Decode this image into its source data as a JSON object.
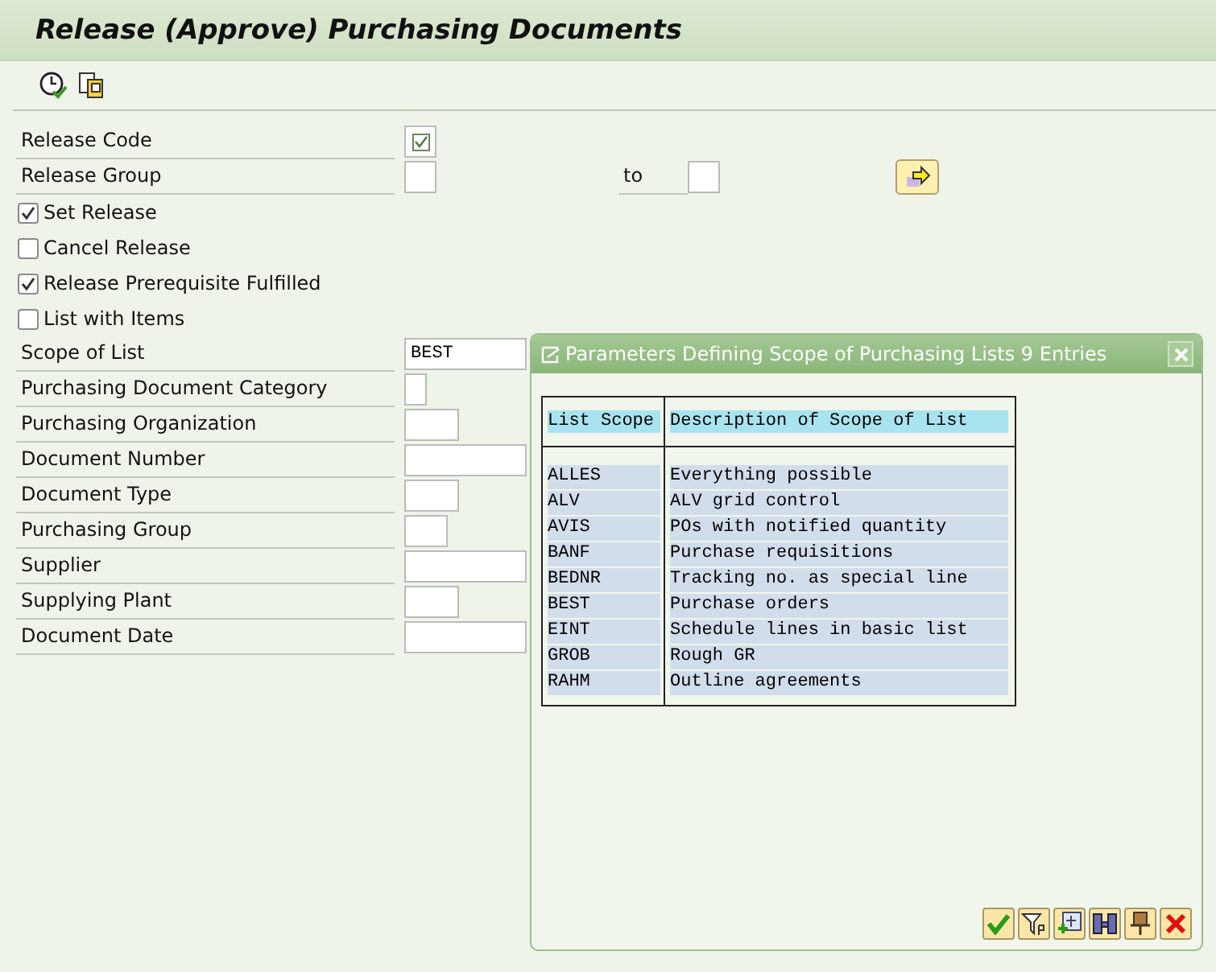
{
  "window": {
    "title": "Release (Approve) Purchasing Documents"
  },
  "form": [
    {
      "kind": "checkfield",
      "label": "Release Code",
      "checked": true
    },
    {
      "kind": "range",
      "label": "Release Group",
      "to_label": "to"
    },
    {
      "kind": "checkbox",
      "label": "Set Release",
      "checked": true
    },
    {
      "kind": "checkbox",
      "label": "Cancel Release",
      "checked": false
    },
    {
      "kind": "checkbox",
      "label": "Release Prerequisite Fulfilled",
      "checked": true
    },
    {
      "kind": "checkbox",
      "label": "List with Items",
      "checked": false
    },
    {
      "kind": "field",
      "label": "Scope of List",
      "value": "BEST"
    },
    {
      "kind": "field",
      "label": "Purchasing Document Category"
    },
    {
      "kind": "field",
      "label": "Purchasing Organization"
    },
    {
      "kind": "field",
      "label": "Document Number"
    },
    {
      "kind": "field",
      "label": "Document Type"
    },
    {
      "kind": "field",
      "label": "Purchasing Group"
    },
    {
      "kind": "field",
      "label": "Supplier"
    },
    {
      "kind": "field",
      "label": "Supplying Plant"
    },
    {
      "kind": "field",
      "label": "Document Date"
    }
  ],
  "dialog": {
    "title": "Parameters Defining Scope of Purchasing Lists 9 Entries",
    "columns": [
      "List Scope",
      "Description of Scope of List"
    ],
    "rows": [
      [
        "ALLES",
        "Everything possible"
      ],
      [
        "ALV",
        "ALV grid control"
      ],
      [
        "AVIS",
        "POs with notified quantity"
      ],
      [
        "BANF",
        "Purchase requisitions"
      ],
      [
        "BEDNR",
        "Tracking no. as special line"
      ],
      [
        "BEST",
        "Purchase orders"
      ],
      [
        "EINT",
        "Schedule lines in basic list"
      ],
      [
        "GROB",
        "Rough GR"
      ],
      [
        "RAHM",
        "Outline agreements"
      ]
    ]
  }
}
